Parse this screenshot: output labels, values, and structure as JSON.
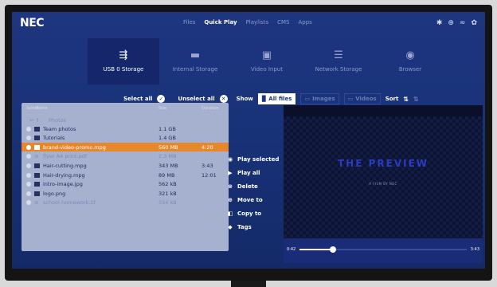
{
  "app": {
    "logo": "NEC"
  },
  "nav": {
    "items": [
      {
        "label": "Files",
        "active": false
      },
      {
        "label": "Quick Play",
        "active": true
      },
      {
        "label": "Playlists",
        "active": false
      },
      {
        "label": "CMS",
        "active": false
      },
      {
        "label": "Apps",
        "active": false
      }
    ]
  },
  "top_icons": [
    "settings-cog-icon",
    "globe-icon",
    "wifi-icon",
    "gear-icon"
  ],
  "sources": [
    {
      "label": "USB 0 Storage",
      "icon": "usb-icon",
      "active": true
    },
    {
      "label": "Internal Storage",
      "icon": "folder-icon",
      "active": false
    },
    {
      "label": "Video Input",
      "icon": "video-input-icon",
      "active": false
    },
    {
      "label": "Network Storage",
      "icon": "server-icon",
      "active": false
    },
    {
      "label": "Browser",
      "icon": "browser-icon",
      "active": false
    }
  ],
  "toolbar": {
    "select_all": "Select all",
    "unselect_all": "Unselect all",
    "show": "Show",
    "all_files": "All files",
    "images": "Images",
    "videos": "Videos",
    "sort": "Sort"
  },
  "file_table": {
    "headers": {
      "select": "Select",
      "name": "Name",
      "size": "Size",
      "duration": "Duration"
    },
    "parent": "Photos",
    "rows": [
      {
        "name": "Team photos",
        "size": "1.1 GB",
        "duration": "",
        "type": "folder",
        "state": "normal"
      },
      {
        "name": "Tutorials",
        "size": "1.4 GB",
        "duration": "",
        "type": "folder",
        "state": "normal"
      },
      {
        "name": "brand-video-promo.mpg",
        "size": "560 MB",
        "duration": "4:20",
        "type": "video",
        "state": "selected"
      },
      {
        "name": "flyer A4 print.pdf",
        "size": "2.3 MB",
        "duration": "",
        "type": "unsupported",
        "state": "disabled"
      },
      {
        "name": "Hair-cutting.mpg",
        "size": "343 MB",
        "duration": "3:43",
        "type": "video",
        "state": "normal"
      },
      {
        "name": "Hair-drying.mpg",
        "size": "89 MB",
        "duration": "12:01",
        "type": "video",
        "state": "normal"
      },
      {
        "name": "intro-image.jpg",
        "size": "562 kB",
        "duration": "",
        "type": "image",
        "state": "normal"
      },
      {
        "name": "logo.png",
        "size": "321 kB",
        "duration": "",
        "type": "image",
        "state": "normal"
      },
      {
        "name": "school-homework.tif",
        "size": "334 kB",
        "duration": "",
        "type": "unsupported",
        "state": "disabled"
      }
    ]
  },
  "actions": [
    {
      "label": "Play selected",
      "icon": "play-selected-icon"
    },
    {
      "label": "Play all",
      "icon": "play-icon"
    },
    {
      "label": "Delete",
      "icon": "delete-icon"
    },
    {
      "label": "Move to",
      "icon": "move-icon"
    },
    {
      "label": "Copy to",
      "icon": "copy-icon"
    },
    {
      "label": "Tags",
      "icon": "tag-icon"
    }
  ],
  "player": {
    "title": "THE PREVIEW",
    "subtitle": "A FILM BY NEC",
    "current_time": "0:42",
    "total_time": "3:43",
    "progress": 0.2
  },
  "colors": {
    "background": "#1e3580",
    "accent": "#e8862a",
    "panel": "#a5b1cf"
  }
}
